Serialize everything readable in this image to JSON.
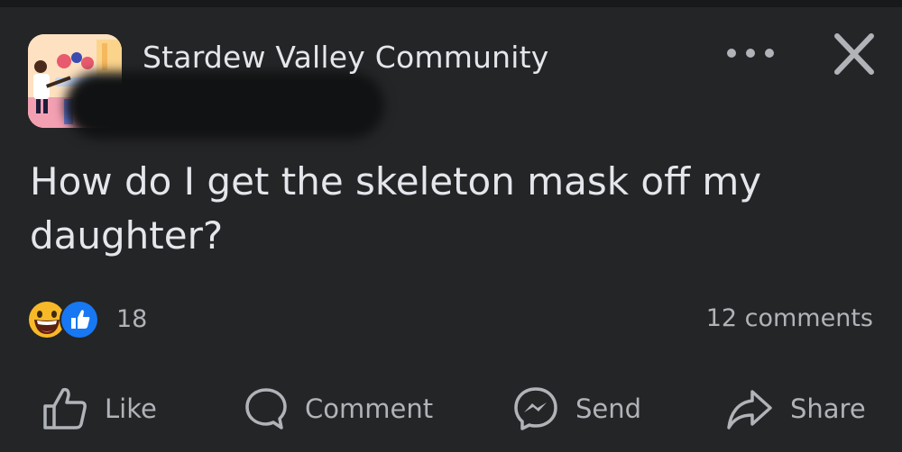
{
  "post": {
    "group_name": "Stardew Valley Community",
    "text": "How do I get the skeleton mask off my daughter?",
    "reaction_count": "18",
    "comments_label": "12 comments"
  },
  "actions": {
    "like": "Like",
    "comment": "Comment",
    "send": "Send",
    "share": "Share"
  },
  "icons": [
    "group-avatar",
    "more-icon",
    "close-icon",
    "haha-reaction-icon",
    "like-reaction-icon",
    "like-icon",
    "comment-icon",
    "messenger-icon",
    "share-icon"
  ],
  "colors": {
    "background": "#242526",
    "text_primary": "#e4e6eb",
    "text_secondary": "#b0b3b8",
    "like_blue": "#1877f2",
    "haha_yellow": "#f7b928"
  }
}
